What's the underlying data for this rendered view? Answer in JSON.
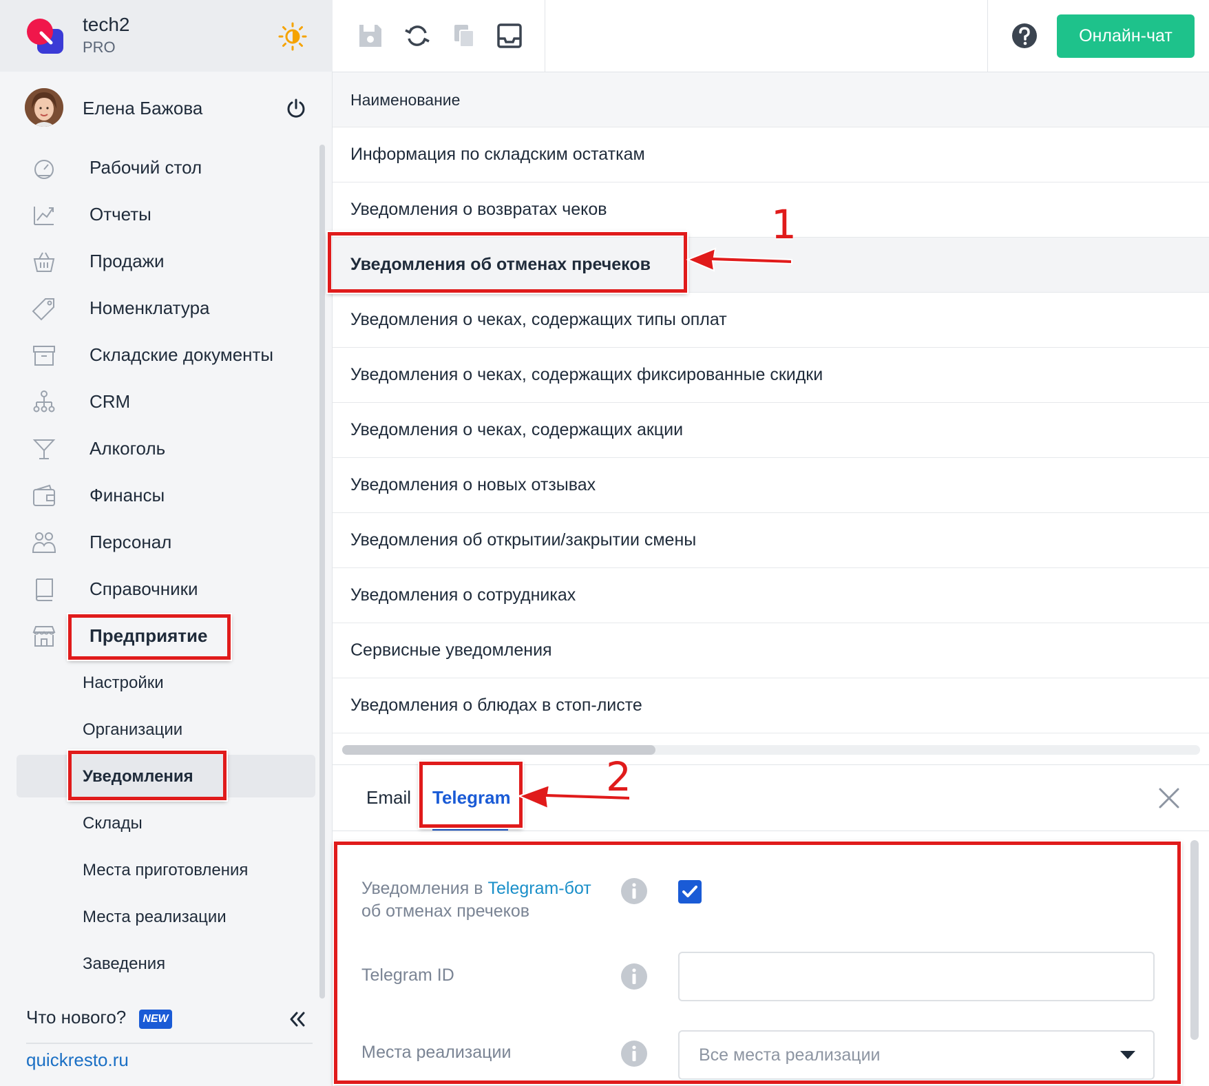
{
  "brand": {
    "name": "tech2",
    "plan": "PRO"
  },
  "profile": {
    "name": "Елена Бажова"
  },
  "sidebar": {
    "nav": [
      {
        "label": "Рабочий стол",
        "icon": "dashboard-icon"
      },
      {
        "label": "Отчеты",
        "icon": "chart-icon"
      },
      {
        "label": "Продажи",
        "icon": "basket-icon"
      },
      {
        "label": "Номенклатура",
        "icon": "tag-icon"
      },
      {
        "label": "Складские документы",
        "icon": "archive-icon"
      },
      {
        "label": "CRM",
        "icon": "org-chart-icon"
      },
      {
        "label": "Алкоголь",
        "icon": "cocktail-icon"
      },
      {
        "label": "Финансы",
        "icon": "wallet-icon"
      },
      {
        "label": "Персонал",
        "icon": "people-icon"
      },
      {
        "label": "Справочники",
        "icon": "book-icon"
      },
      {
        "label": "Предприятие",
        "icon": "store-icon"
      }
    ],
    "sub": [
      "Настройки",
      "Организации",
      "Уведомления",
      "Склады",
      "Места приготовления",
      "Места реализации",
      "Заведения"
    ],
    "whats_new": "Что нового?",
    "new_badge": "NEW",
    "site": "quickresto.ru"
  },
  "toolbar": {
    "chat_label": "Онлайн-чат"
  },
  "table": {
    "header": "Наименование",
    "rows": [
      "Информация по складским остаткам",
      "Уведомления о возвратах чеков",
      "Уведомления об отменах пречеков",
      "Уведомления о чеках, содержащих типы оплат",
      "Уведомления о чеках, содержащих фиксированные скидки",
      "Уведомления о чеках, содержащих акции",
      "Уведомления о новых отзывах",
      "Уведомления об открытии/закрытии смены",
      "Уведомления о сотрудниках",
      "Сервисные уведомления",
      "Уведомления о блюдах в стоп-листе"
    ]
  },
  "panel": {
    "tabs": [
      "Email",
      "Telegram"
    ],
    "label1_pre": "Уведомления в ",
    "label1_link": "Telegram-бот",
    "label1_post": "об отменах пречеков",
    "label2": "Telegram ID",
    "label3": "Места реализации",
    "select_value": "Все места реализации"
  },
  "annotations": {
    "one": "1",
    "two": "2"
  },
  "colors": {
    "accent": "#1a5bd6",
    "chat": "#1ec28b",
    "highlight": "#e01b1b"
  }
}
